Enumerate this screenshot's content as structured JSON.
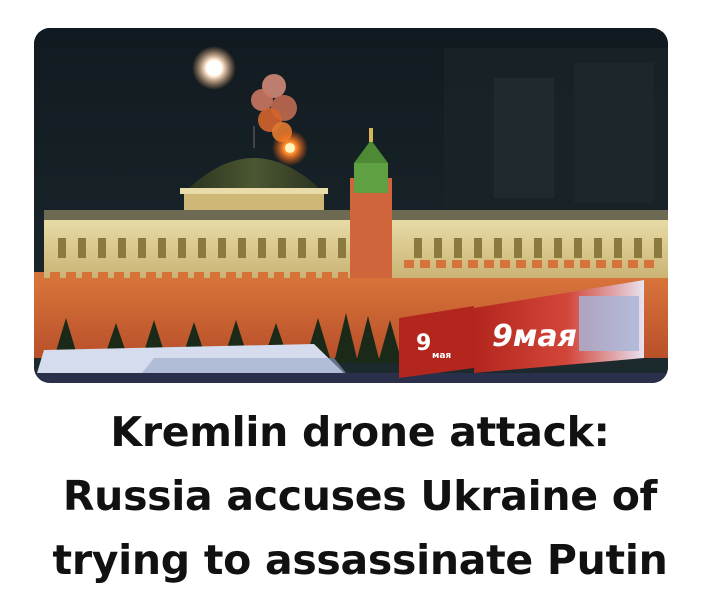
{
  "headline": {
    "lines": [
      "Kremlin drone attack:",
      "Russia accuses Ukraine of",
      "trying to assassinate Putin"
    ]
  },
  "photo": {
    "billboard_small_text": "9",
    "billboard_small_sub": "мая",
    "billboard_large_text": "9мая",
    "colors": {
      "night_sky": "#0e1418",
      "kremlin_wall": "#c8622e",
      "palace_facade": "#d9c48a",
      "dome": "#3f4a2c",
      "tower_green": "#5fa043",
      "fire": "#ff7a2a",
      "billboard_red": "#c0392b"
    }
  }
}
